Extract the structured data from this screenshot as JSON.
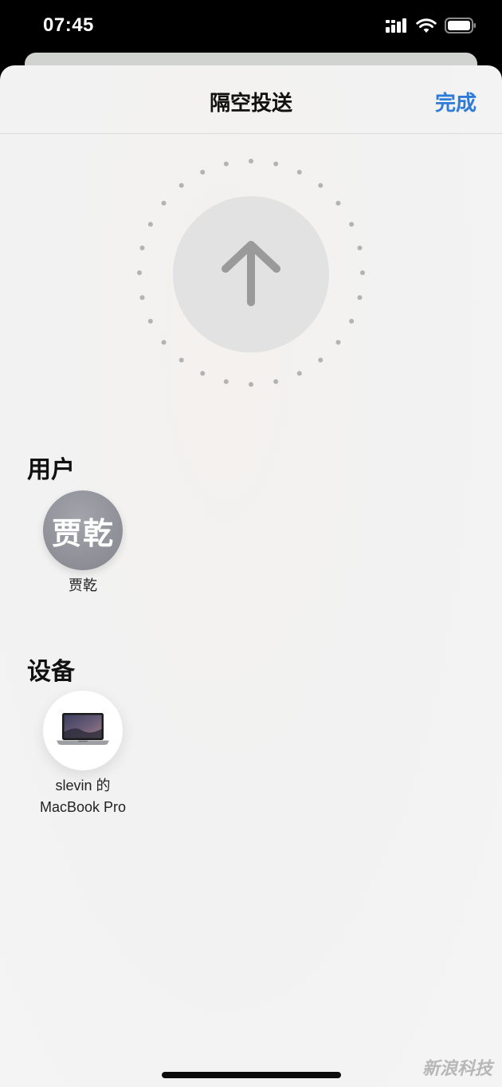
{
  "status_bar": {
    "time": "07:45",
    "icons": [
      "signal-icon",
      "wifi-icon",
      "battery-icon"
    ]
  },
  "nav": {
    "title": "隔空投送",
    "done_label": "完成"
  },
  "airdrop": {
    "icon": "arrow-up-icon"
  },
  "people_section": {
    "title": "用户",
    "items": [
      {
        "initials": "贾乾",
        "name": "贾乾"
      }
    ]
  },
  "devices_section": {
    "title": "设备",
    "items": [
      {
        "name_line1": "slevin 的",
        "name_line2": "MacBook Pro",
        "icon": "macbook-icon"
      }
    ]
  },
  "watermark": "新浪科技",
  "colors": {
    "accent": "#2f7bd8",
    "avatar_bg": "#8d8e96",
    "sheet_bg": "#f2f2f2"
  }
}
